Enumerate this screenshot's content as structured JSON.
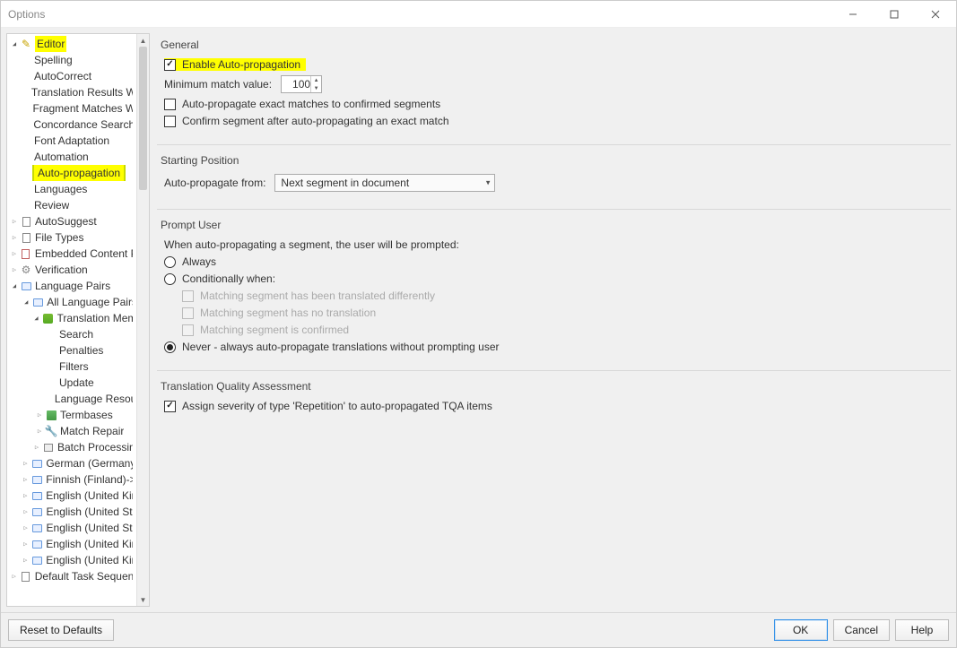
{
  "window": {
    "title": "Options"
  },
  "tree": {
    "editor": "Editor",
    "editor_children": [
      "Spelling",
      "AutoCorrect",
      "Translation Results Win",
      "Fragment Matches Wi",
      "Concordance Search",
      "Font Adaptation",
      "Automation"
    ],
    "auto_propagation": "Auto-propagation",
    "editor_children_after": [
      "Languages",
      "Review"
    ],
    "autosuggest": "AutoSuggest",
    "file_types": "File Types",
    "embedded": "Embedded Content Pr",
    "verification": "Verification",
    "language_pairs": "Language Pairs",
    "all_language_pairs": "All Language Pairs",
    "translation_memo": "Translation Memo",
    "tm_children": [
      "Search",
      "Penalties",
      "Filters",
      "Update",
      "Language Resour"
    ],
    "termbases": "Termbases",
    "match_repair": "Match Repair",
    "batch_processing": "Batch Processing",
    "lp_rows": [
      "German (Germany)-",
      "Finnish (Finland)->E",
      "English (United King",
      "English (United Stat",
      "English (United Stat",
      "English (United King",
      "English (United King"
    ],
    "default_task_sequence": "Default Task Sequence"
  },
  "sections": {
    "general": {
      "title": "General",
      "enable": "Enable Auto-propagation",
      "min_label": "Minimum match value:",
      "min_value": "100",
      "exact": "Auto-propagate exact matches to confirmed segments",
      "confirm": "Confirm segment after auto-propagating an exact match"
    },
    "starting": {
      "title": "Starting Position",
      "from_label": "Auto-propagate from:",
      "from_value": "Next segment in document"
    },
    "prompt": {
      "title": "Prompt User",
      "intro": "When auto-propagating a segment, the user will be prompted:",
      "always": "Always",
      "conditionally": "Conditionally when:",
      "c1": "Matching segment has been translated differently",
      "c2": "Matching segment has no translation",
      "c3": "Matching segment is confirmed",
      "never": "Never - always auto-propagate translations without prompting user"
    },
    "tqa": {
      "title": "Translation Quality Assessment",
      "assign": "Assign severity of type 'Repetition' to auto-propagated TQA items"
    }
  },
  "footer": {
    "reset": "Reset to Defaults",
    "ok": "OK",
    "cancel": "Cancel",
    "help": "Help"
  }
}
